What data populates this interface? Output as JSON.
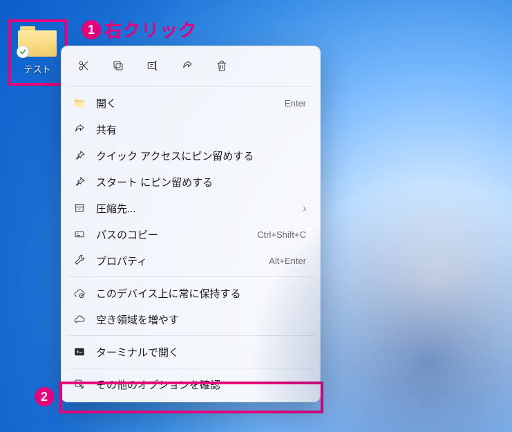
{
  "folder": {
    "label": "テスト"
  },
  "annotations": {
    "one_number": "1",
    "one_text": "右クリック",
    "two_number": "2"
  },
  "menu": {
    "open": {
      "label": "開く",
      "shortcut": "Enter"
    },
    "share": {
      "label": "共有"
    },
    "pin_quick_access": {
      "label": "クイック アクセスにピン留めする"
    },
    "pin_start": {
      "label": "スタート にピン留めする"
    },
    "compress": {
      "label": "圧縮先..."
    },
    "copy_path": {
      "label": "パスのコピー",
      "shortcut": "Ctrl+Shift+C"
    },
    "properties": {
      "label": "プロパティ",
      "shortcut": "Alt+Enter"
    },
    "keep_on_device": {
      "label": "このデバイス上に常に保持する"
    },
    "free_space": {
      "label": "空き領域を増やす"
    },
    "open_terminal": {
      "label": "ターミナルで開く"
    },
    "more_options": {
      "label": "その他のオプションを確認"
    }
  }
}
